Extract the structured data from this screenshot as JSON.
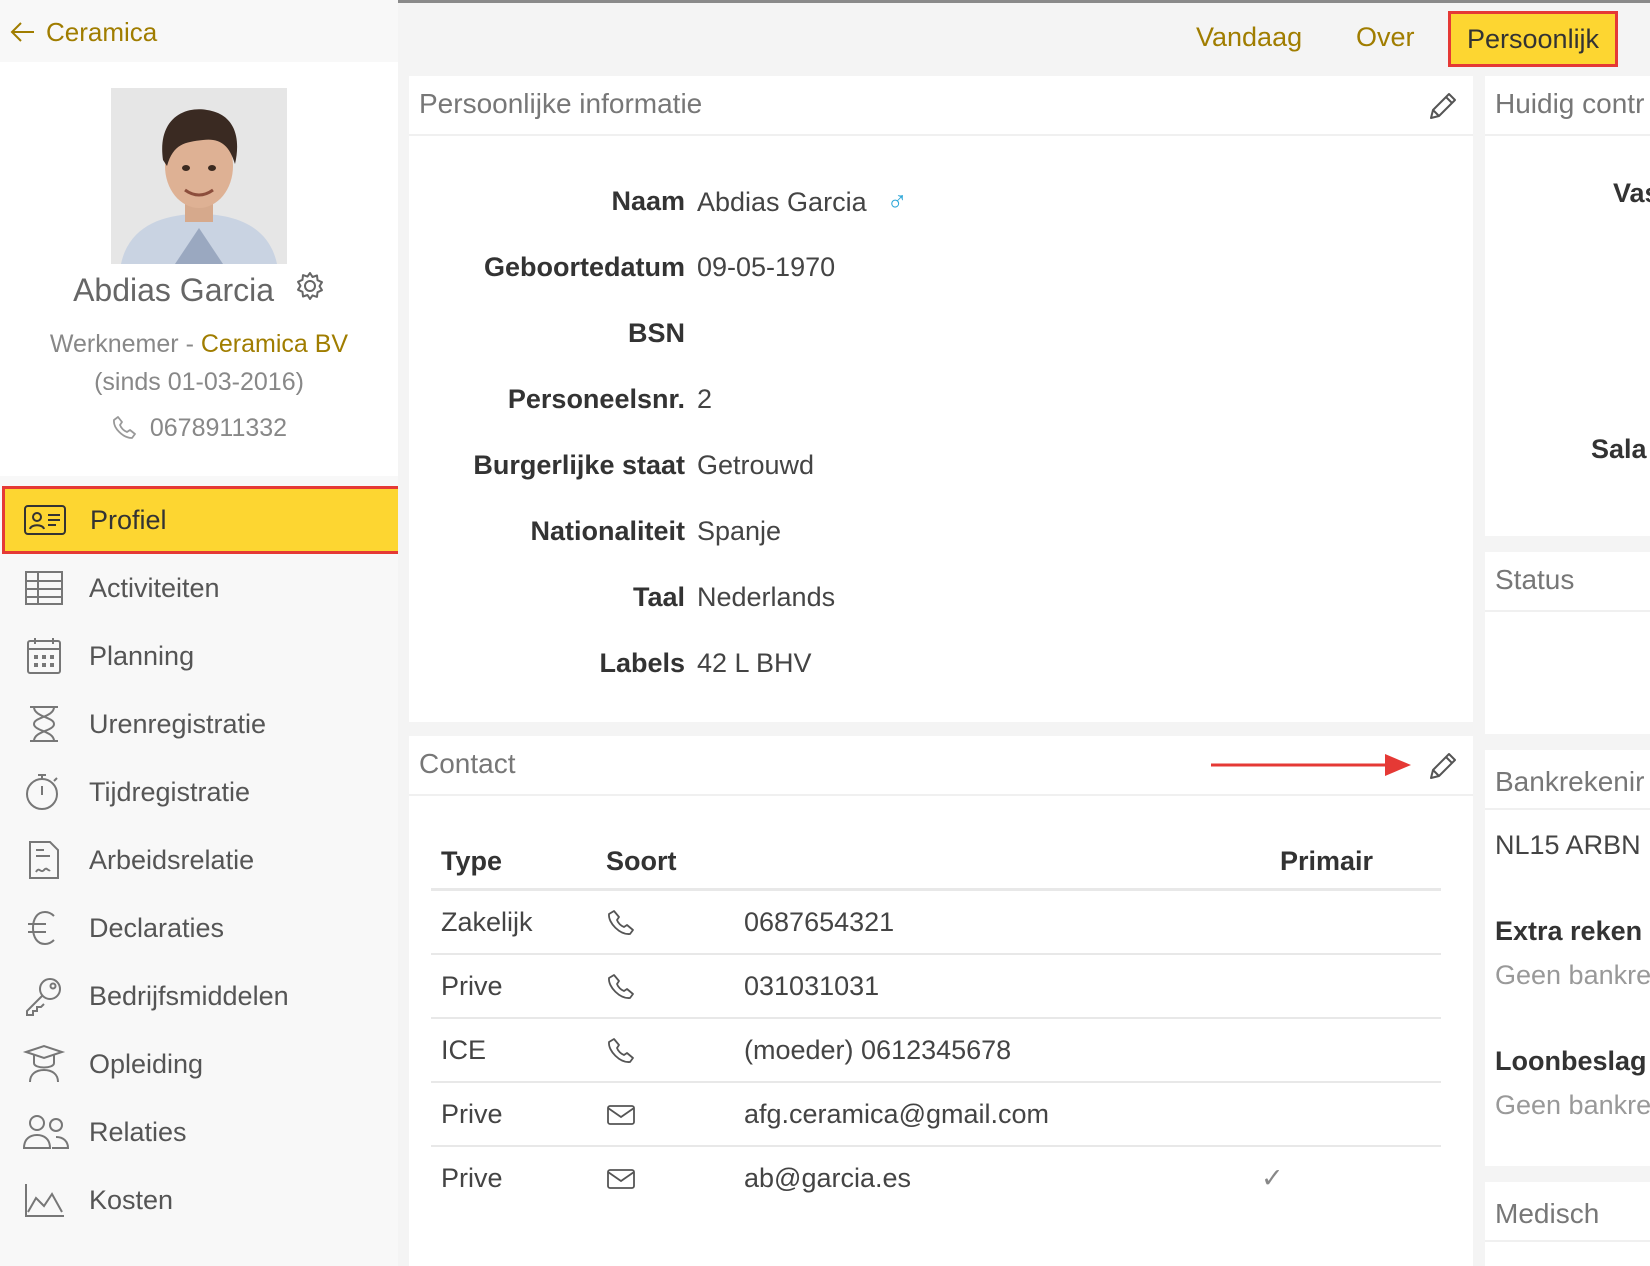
{
  "sidebar": {
    "back_label": "Ceramica",
    "employee_name": "Abdias Garcia",
    "role": "Werknemer",
    "separator": " - ",
    "company": "Ceramica BV",
    "since": "(sinds 01-03-2016)",
    "phone": "0678911332",
    "nav": [
      {
        "label": "Profiel",
        "icon": "id-card-icon"
      },
      {
        "label": "Activiteiten",
        "icon": "table-icon"
      },
      {
        "label": "Planning",
        "icon": "calendar-icon"
      },
      {
        "label": "Urenregistratie",
        "icon": "hourglass-icon"
      },
      {
        "label": "Tijdregistratie",
        "icon": "stopwatch-icon"
      },
      {
        "label": "Arbeidsrelatie",
        "icon": "contract-icon"
      },
      {
        "label": "Declaraties",
        "icon": "euro-icon"
      },
      {
        "label": "Bedrijfsmiddelen",
        "icon": "key-icon"
      },
      {
        "label": "Opleiding",
        "icon": "graduate-icon"
      },
      {
        "label": "Relaties",
        "icon": "people-icon"
      },
      {
        "label": "Kosten",
        "icon": "area-chart-icon"
      }
    ]
  },
  "topbar": {
    "tabs": [
      "Vandaag",
      "Over",
      "Persoonlijk"
    ]
  },
  "personal_info": {
    "title": "Persoonlijke informatie",
    "rows": [
      {
        "label": "Naam",
        "value": "Abdias Garcia"
      },
      {
        "label": "Geboortedatum",
        "value": "09-05-1970"
      },
      {
        "label": "BSN",
        "value": ""
      },
      {
        "label": "Personeelsnr.",
        "value": "2"
      },
      {
        "label": "Burgerlijke staat",
        "value": "Getrouwd"
      },
      {
        "label": "Nationaliteit",
        "value": "Spanje"
      },
      {
        "label": "Taal",
        "value": "Nederlands"
      },
      {
        "label": "Labels",
        "value": "42 L BHV"
      }
    ],
    "gender_symbol": "♂"
  },
  "contact": {
    "title": "Contact",
    "headers": {
      "type": "Type",
      "soort": "Soort",
      "primair": "Primair"
    },
    "rows": [
      {
        "type": "Zakelijk",
        "soort": "phone",
        "value": "0687654321",
        "primary": ""
      },
      {
        "type": "Prive",
        "soort": "phone",
        "value": "031031031",
        "primary": ""
      },
      {
        "type": "ICE",
        "soort": "phone",
        "value": "(moeder) 0612345678",
        "primary": ""
      },
      {
        "type": "Prive",
        "soort": "email",
        "value": "afg.ceramica@gmail.com",
        "primary": ""
      },
      {
        "type": "Prive",
        "soort": "email",
        "value": "ab@garcia.es",
        "primary": "✓"
      }
    ]
  },
  "right_column": {
    "contract_title": "Huidig contr",
    "contract_label_1": "Vas",
    "contract_label_2": "Sala",
    "status_title": "Status",
    "bank_title": "Bankrekenir",
    "bank_account": "NL15 ARBN",
    "extra_title": "Extra reken",
    "extra_value": "Geen bankre",
    "loonbeslag_title": "Loonbeslag",
    "loonbeslag_value": "Geen bankre",
    "medisch_title": "Medisch"
  },
  "colors": {
    "accent": "#a07d00",
    "highlight": "#fdd631",
    "annotation": "#e53935"
  }
}
